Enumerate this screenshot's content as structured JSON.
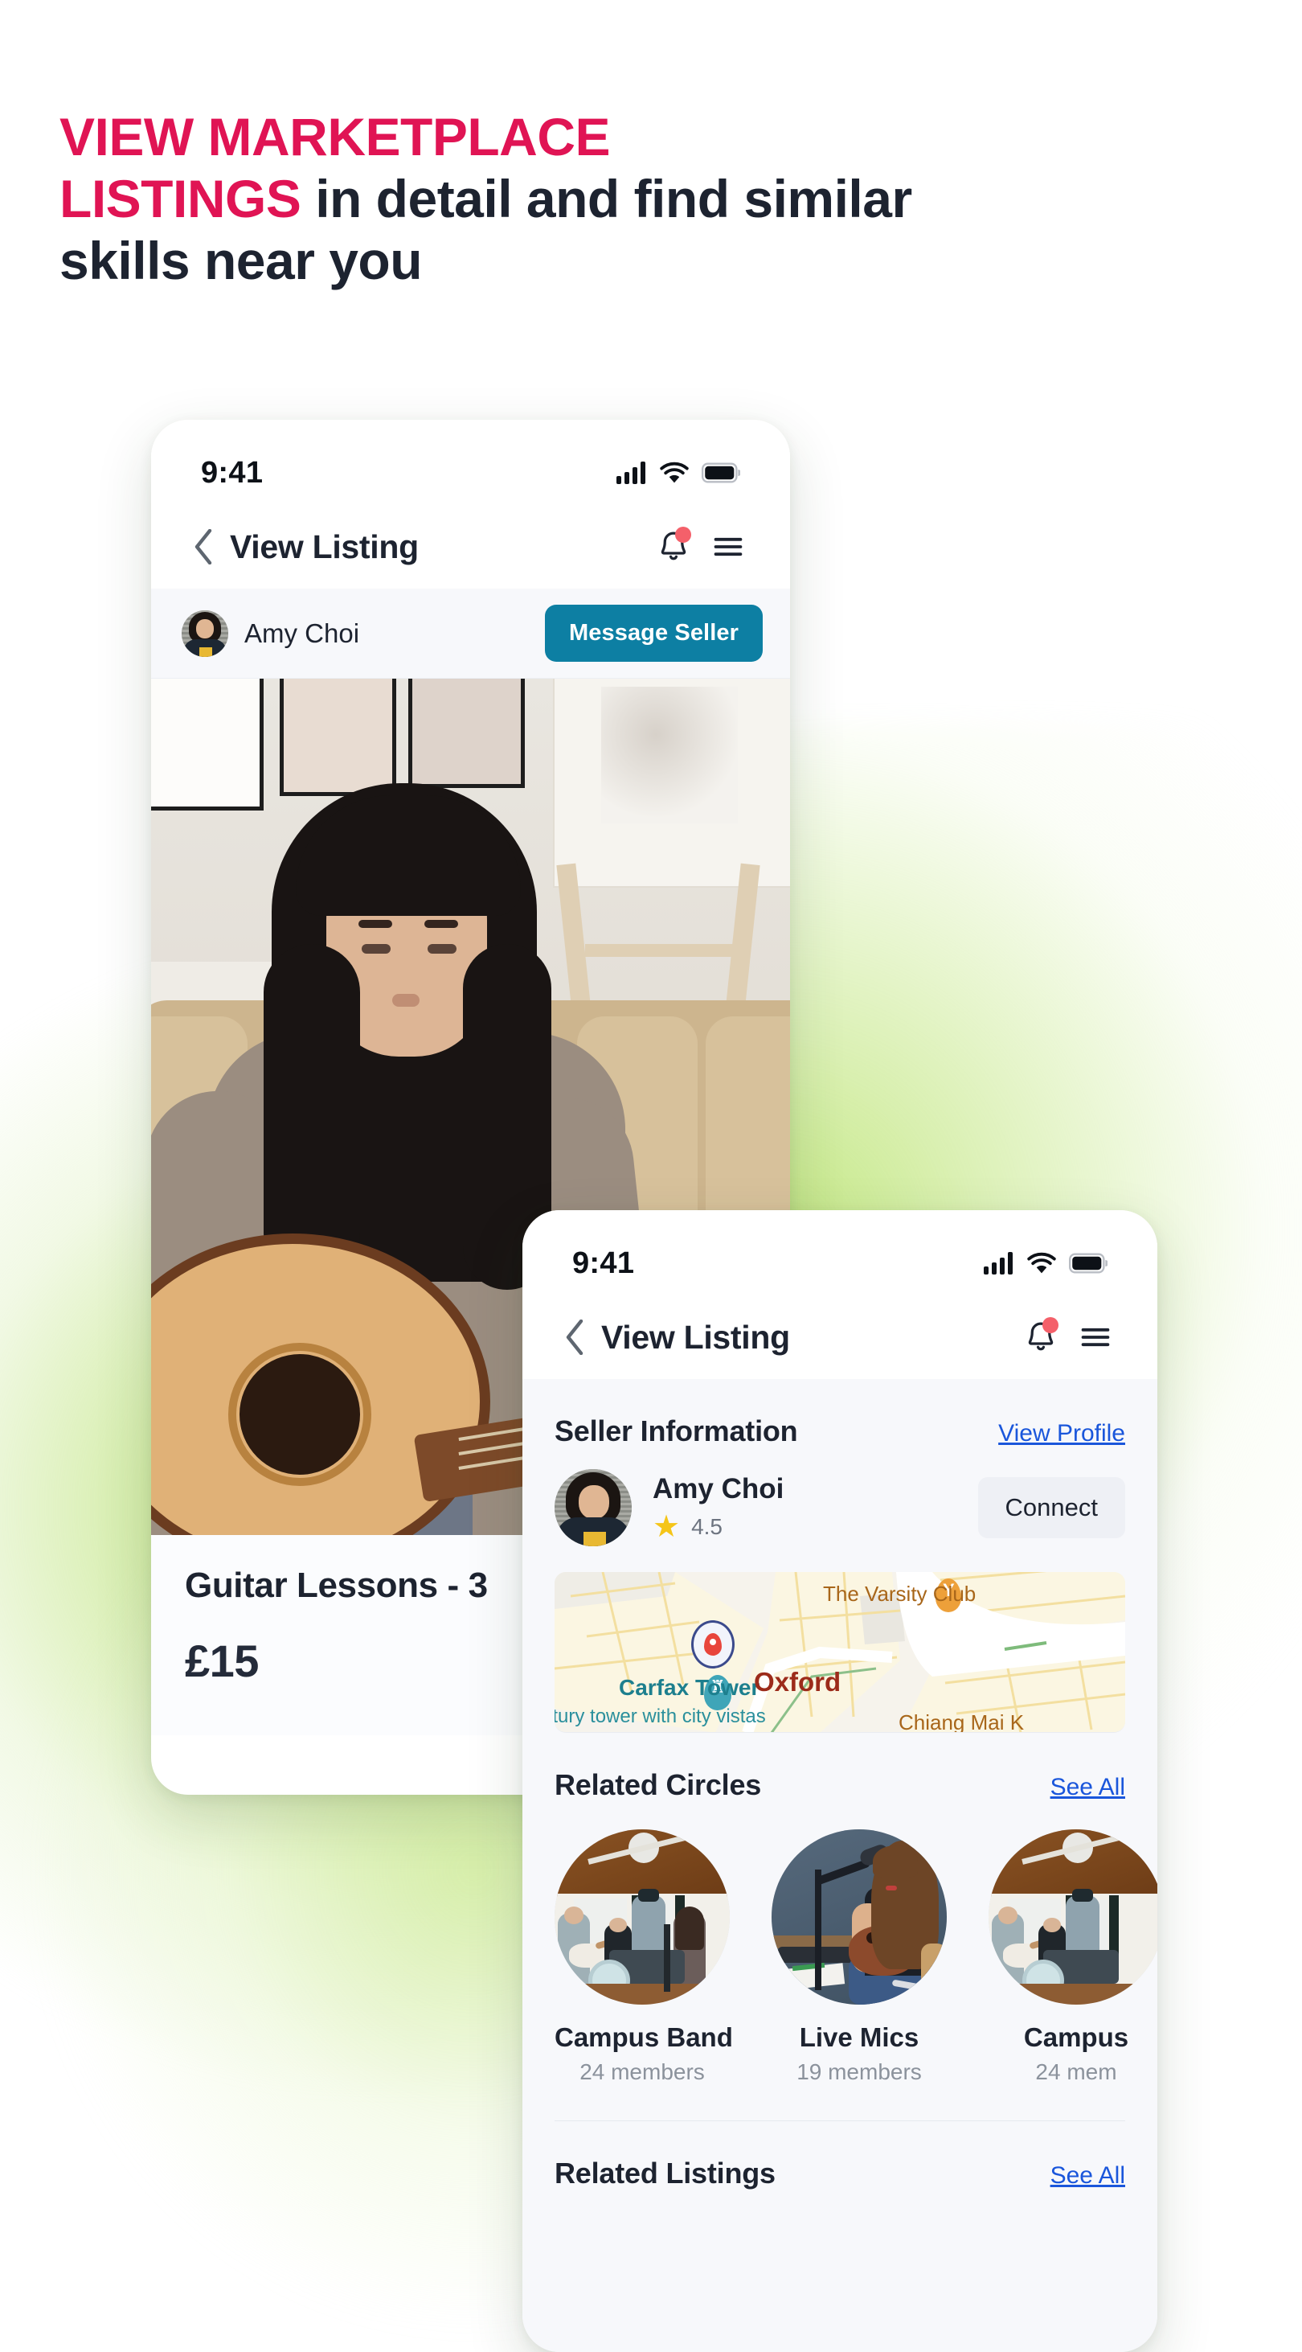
{
  "headline": {
    "pink_part": "VIEW MARKETPLACE LISTINGS",
    "line1_pink": "VIEW MARKETPLACE",
    "line2_pink": "LISTINGS",
    "line2_dark": " in detail and find similar",
    "line3_dark": "skills near you",
    "pink_color": "#e01454",
    "dark_color": "#1d2330"
  },
  "phone1": {
    "status": {
      "time": "9:41",
      "cellular": "signal-bars",
      "wifi": "wifi",
      "battery": "battery-full"
    },
    "nav": {
      "back": "chevron-left",
      "title": "View Listing",
      "bell": "bell-icon",
      "menu": "hamburger-menu"
    },
    "seller_strip": {
      "avatar": "amy-choi-avatar",
      "name": "Amy Choi",
      "message_button": "Message Seller",
      "message_button_color": "#0d7fa3"
    },
    "hero": {
      "alt": "woman playing acoustic guitar on couch"
    },
    "listing": {
      "title": "Guitar Lessons - 3",
      "price": "£15"
    }
  },
  "phone2": {
    "status": {
      "time": "9:41",
      "cellular": "signal-bars",
      "wifi": "wifi",
      "battery": "battery-full"
    },
    "nav": {
      "back": "chevron-left",
      "title": "View Listing",
      "bell": "bell-icon",
      "menu": "hamburger-menu"
    },
    "seller_information": {
      "title": "Seller Information",
      "link": "View Profile",
      "name": "Amy Choi",
      "rating": "4.5",
      "star": "★",
      "connect_button": "Connect"
    },
    "map": {
      "labels": {
        "varsity": "The Varsity Club",
        "carfax": "Carfax Tower",
        "carfax_sub": "ntury tower with city vistas",
        "oxford": "Oxford",
        "chiang": "Chiang Mai K"
      },
      "user_pin": "location-pin",
      "poi_tower": "tower-poi-icon",
      "poi_bar": "bar-poi-icon"
    },
    "related_circles": {
      "title": "Related Circles",
      "link": "See All",
      "items": [
        {
          "name": "Campus Band",
          "members": "24 members",
          "image": "band-practice-photo"
        },
        {
          "name": "Live Mics",
          "members": "19 members",
          "image": "singer-guitar-photo"
        },
        {
          "name": "Campus",
          "members": "24 mem",
          "image": "band-practice-photo"
        }
      ]
    },
    "related_listings": {
      "title": "Related Listings",
      "link": "See All"
    }
  }
}
